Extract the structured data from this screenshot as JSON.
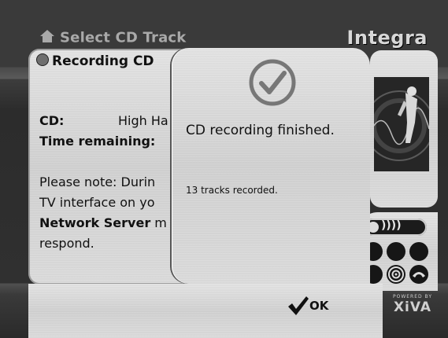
{
  "screen": {
    "title": "Select CD Track",
    "brand": "Integra",
    "powered_by": "POWERED BY",
    "powered_name": "XiVA"
  },
  "recording_panel": {
    "header": "Recording CD",
    "cd_label": "CD:",
    "cd_value": "High Ha",
    "time_label": "Time remaining:",
    "note_line1": "Please note: Durin",
    "note_line2": "TV interface on yo",
    "note_line3_bold": "Network Server",
    "note_line3_rest": " m",
    "note_line4": "respond."
  },
  "dialog": {
    "message": "CD recording finished.",
    "count_text": "13 tracks recorded.",
    "ok_label": "OK"
  },
  "controls": {
    "volume_glyph": "))))"
  },
  "colors": {
    "panel": "#d9d9d9",
    "dark": "#111111",
    "title_text": "#a9a9a9"
  }
}
